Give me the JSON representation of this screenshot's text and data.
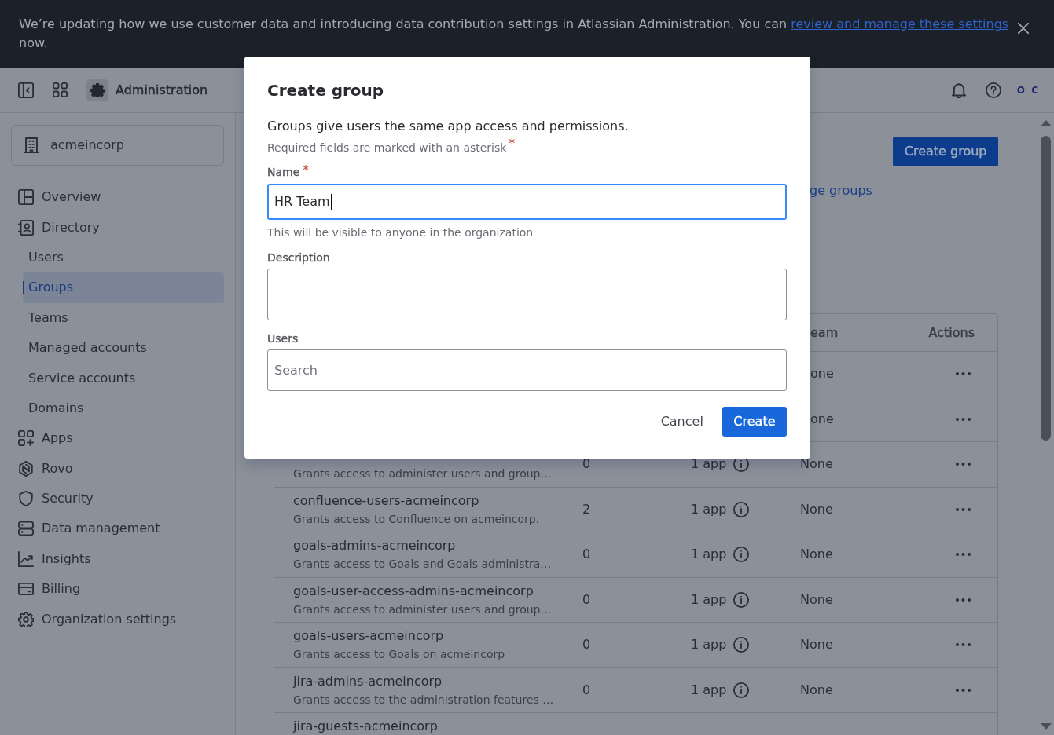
{
  "banner": {
    "message": "We’re updating how we use customer data and introducing data contribution settings in Atlassian Administration. You can",
    "link": "review and manage these settings",
    "message_end": "now."
  },
  "header": {
    "title": "Administration",
    "logo": "O C"
  },
  "sidebar": {
    "organization": "acmeincorp",
    "items": [
      {
        "label": "Overview",
        "selected": false
      },
      {
        "label": "Directory",
        "selected": false,
        "children": [
          {
            "label": "Users",
            "selected": false
          },
          {
            "label": "Groups",
            "selected": true
          },
          {
            "label": "Teams",
            "selected": false
          },
          {
            "label": "Managed accounts",
            "selected": false
          },
          {
            "label": "Service accounts",
            "selected": false
          },
          {
            "label": "Domains",
            "selected": false
          }
        ]
      },
      {
        "label": "Apps",
        "selected": false
      },
      {
        "label": "Rovo",
        "selected": false
      },
      {
        "label": "Security",
        "selected": false
      },
      {
        "label": "Data management",
        "selected": false
      },
      {
        "label": "Insights",
        "selected": false
      },
      {
        "label": "Billing",
        "selected": false
      },
      {
        "label": "Organization settings",
        "selected": false
      }
    ]
  },
  "page": {
    "primary_button": "Create group",
    "link": "ge groups",
    "table": {
      "columns": {
        "column_4": "eam",
        "actions": "Actions"
      },
      "rows": [
        {
          "column_4": "one"
        },
        {
          "column_4": "one"
        },
        {
          "description": "Grants access to administer users and group…",
          "count": "0",
          "apps": "1 app",
          "column_4": "None"
        },
        {
          "name": "confluence-users-acmeincorp",
          "description": "Grants access to Confluence on acmeincorp.",
          "count": "2",
          "apps": "1 app",
          "column_4": "None"
        },
        {
          "name": "goals-admins-acmeincorp",
          "description": "Grants access to Goals and Goals administra…",
          "count": "0",
          "apps": "1 app",
          "column_4": "None"
        },
        {
          "name": "goals-user-access-admins-acmeincorp",
          "description": "Grants access to administer users and group…",
          "count": "0",
          "apps": "1 app",
          "column_4": "None"
        },
        {
          "name": "goals-users-acmeincorp",
          "description": "Grants access to Goals on acmeincorp",
          "count": "0",
          "apps": "1 app",
          "column_4": "None"
        },
        {
          "name": "jira-admins-acmeincorp",
          "description": "Grants access to the administration features …",
          "count": "0",
          "apps": "1 app",
          "column_4": "None"
        },
        {
          "name": "jira-guests-acmeincorp"
        }
      ]
    }
  },
  "modal": {
    "title": "Create group",
    "intro": "Groups give users the same app access and permissions.",
    "note": "Required fields are marked with an asterisk",
    "note_mark": "*",
    "fields": [
      {
        "kind": "text",
        "label": "Name",
        "required_mark": "*",
        "value": "HR Team",
        "focused": true,
        "help": "This will be visible to anyone in the organization"
      },
      {
        "kind": "textarea",
        "label": "Description",
        "focused": false
      },
      {
        "kind": "picker",
        "label": "Users",
        "placeholder": "Search",
        "focused": false
      }
    ],
    "buttons": [
      {
        "kind": "subtle",
        "label": "Cancel"
      },
      {
        "kind": "primary",
        "label": "Create"
      }
    ]
  }
}
